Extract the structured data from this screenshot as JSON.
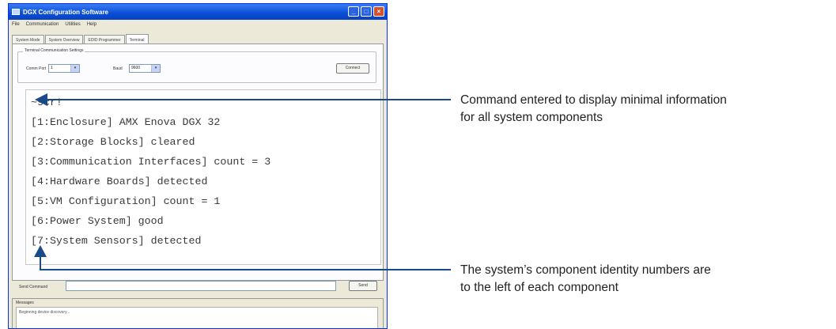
{
  "window": {
    "title": "DGX Configuration Software",
    "controls": [
      "_",
      "□",
      "×"
    ]
  },
  "menu": [
    "File",
    "Communication",
    "Utilities",
    "Help"
  ],
  "tabs": [
    "System Mode",
    "System Overview",
    "EDID Programmer",
    "Terminal"
  ],
  "active_tab": "Terminal",
  "settings": {
    "group_title": "Terminal Communication Settings",
    "comm_port_label": "Comm Port",
    "comm_port_value": "1",
    "baud_label": "Baud",
    "baud_value": "9600",
    "connect_label": "Connect"
  },
  "terminal_lines": [
    "~scr!",
    "[1:Enclosure] AMX Enova DGX 32",
    "[2:Storage Blocks] cleared",
    "[3:Communication Interfaces] count = 3",
    "[4:Hardware Boards] detected",
    "[5:VM Configuration] count = 1",
    "[6:Power System] good",
    "[7:System Sensors] detected"
  ],
  "send": {
    "label": "Send Command",
    "value": "",
    "button_label": "Send"
  },
  "messages": {
    "title": "Messages",
    "lines": [
      "Beginning device discovery..."
    ]
  },
  "annotations": {
    "top": [
      "Command entered to display minimal information",
      "for all system components"
    ],
    "bottom": [
      "The system’s component identity numbers are",
      "to the left of each component"
    ]
  },
  "colors": {
    "titlebar": "#0a4ed6",
    "arrow": "#1b4a8a"
  }
}
